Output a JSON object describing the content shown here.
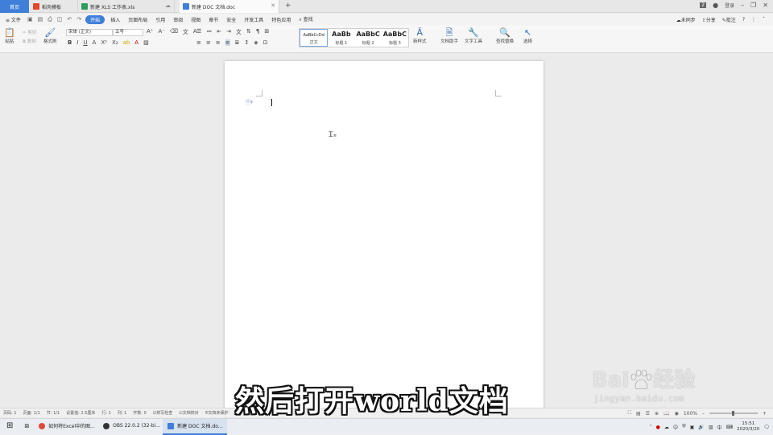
{
  "tabs": {
    "home": "首页",
    "items": [
      {
        "label": "稻壳模板",
        "color": "#e2462c"
      },
      {
        "label": "新建 XLS 工作表.xls",
        "color": "#2e9b5f"
      },
      {
        "label": "新建 DOC 文档.doc",
        "color": "#3f7fd9"
      }
    ],
    "add": "+"
  },
  "window": {
    "badge": "2",
    "user": "登录",
    "min": "–",
    "restore": "❐",
    "close": "✕"
  },
  "menu": {
    "file": "≡ 文件",
    "items": [
      "开始",
      "插入",
      "页面布局",
      "引用",
      "审阅",
      "视图",
      "章节",
      "安全",
      "开发工具",
      "特色应用"
    ],
    "active_index": 0,
    "search": "查找",
    "sync": "未同步",
    "share": "分享",
    "comment": "批注",
    "help": "?"
  },
  "ribbon": {
    "paste": "粘贴",
    "cut": "剪切",
    "copy": "复制",
    "format_painter": "格式刷",
    "font_name": "宋体 (正文)",
    "font_size": "五号",
    "styles": [
      {
        "preview": "AaBbCcDd",
        "name": "正文"
      },
      {
        "preview": "AaBb",
        "name": "标题 1"
      },
      {
        "preview": "AaBbC",
        "name": "标题 2"
      },
      {
        "preview": "AaBbC",
        "name": "标题 3"
      }
    ],
    "new_style": "新样式",
    "doc_assistant": "文档助手",
    "text_tools": "文字工具",
    "find_replace": "查找替换",
    "select": "选择"
  },
  "status": {
    "page": "页码: 1",
    "pages": "页面: 1/1",
    "section": "节: 1/1",
    "setting": "设置值: 2.5厘米",
    "row": "行: 1",
    "col": "列: 1",
    "words": "字数: 0",
    "spell": "拼写检查",
    "doc_check": "文档校对",
    "protect": "文档未保护",
    "zoom": "100%"
  },
  "caption": "然后打开world文档",
  "watermark": {
    "brand": "Bai",
    "brand2": "经验",
    "url": "jingyan.baidu.com"
  },
  "taskbar": {
    "items": [
      {
        "label": "如何将Excel中的图...",
        "color": "#dd4b39"
      },
      {
        "label": "OBS 22.0.2 (32-bi...",
        "color": "#333"
      },
      {
        "label": "新建 DOC 文档.do...",
        "color": "#3f7fd9"
      }
    ],
    "ime": "中",
    "time": "15:51",
    "date": "2020/3/20"
  }
}
